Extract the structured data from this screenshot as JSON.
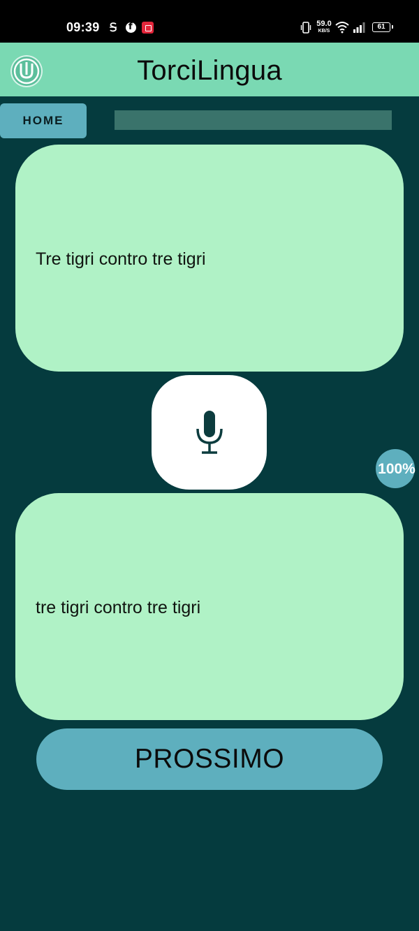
{
  "status_bar": {
    "time": "09:39",
    "net_speed_value": "59.0",
    "net_speed_unit": "KB/S",
    "battery": "61",
    "icons": [
      "s-icon",
      "facebook-icon",
      "screen-record-icon",
      "vibrate-icon",
      "wifi-icon",
      "signal-icon",
      "battery-icon"
    ]
  },
  "app_bar": {
    "title": "TorciLingua",
    "logo_icon": "app-logo-icon"
  },
  "nav": {
    "home_label": "HOME"
  },
  "prompt_card": {
    "text": "Tre tigri contro tre tigri"
  },
  "result_card": {
    "text": "tre tigri contro tre tigri"
  },
  "mic": {
    "icon": "microphone-icon"
  },
  "score": {
    "value": "100%"
  },
  "next": {
    "label": "PROSSIMO"
  },
  "colors": {
    "background": "#053b3e",
    "app_bar": "#7ad9b3",
    "card": "#b0f2c6",
    "accent": "#5eafbe"
  }
}
